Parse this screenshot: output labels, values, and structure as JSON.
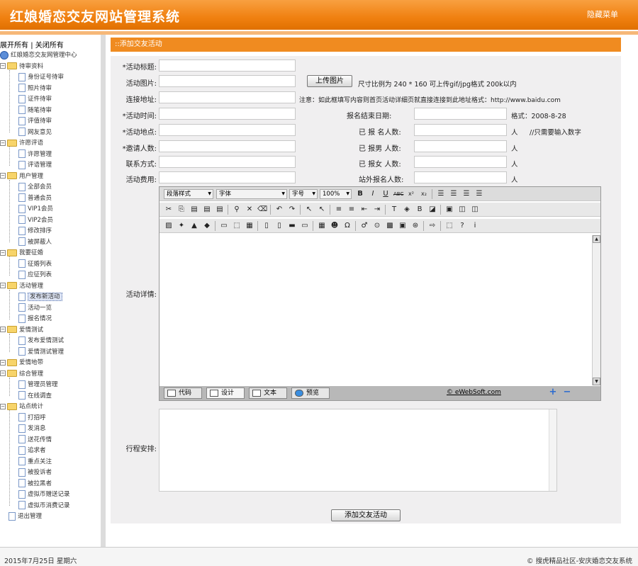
{
  "header": {
    "title": "红娘婚恋交友网站管理系统",
    "hide_menu": "隐藏菜单"
  },
  "sidebar": {
    "expand_all": "展开所有",
    "collapse_all": "关闭所有",
    "root": "红娘婚恋交友网管理中心",
    "groups": [
      {
        "label": "待审资料",
        "items": [
          "身份证号待审",
          "照片待审",
          "证件待审",
          "随笔待审",
          "评值待审",
          "网友意见"
        ]
      },
      {
        "label": "许愿评语",
        "items": [
          "许愿管理",
          "评语管理"
        ]
      },
      {
        "label": "用户管理",
        "items": [
          "全部会员",
          "普通会员",
          "VIP1会员",
          "VIP2会员",
          "修改排序",
          "被屏蔽人"
        ]
      },
      {
        "label": "我要征婚",
        "items": [
          "征婚列表",
          "应征列表"
        ]
      },
      {
        "label": "活动管理",
        "items": [
          "发布新活动",
          "活动一览",
          "报名情况"
        ]
      },
      {
        "label": "爱情测试",
        "items": [
          "发布爱情测试",
          "爱情测试管理"
        ]
      },
      {
        "label": "爱情地带",
        "items": []
      },
      {
        "label": "综合管理",
        "items": [
          "管理员管理",
          "在线调查"
        ]
      },
      {
        "label": "站点统计",
        "items": [
          "打招呼",
          "发消息",
          "送花传情",
          "追求者",
          "重点关注",
          "被投诉者",
          "被拉黑者",
          "虚拟币赠送记录",
          "虚拟币消费记录"
        ]
      }
    ],
    "logout": "退出管理"
  },
  "panel": {
    "title": "::添加交友活动"
  },
  "form": {
    "title_label": "*活动标题:",
    "image_label": "活动图片:",
    "upload_button": "上传图片",
    "image_hint": "尺寸比例为 240 * 160 可上传gif/jpg格式 200k以内",
    "link_label": "连接地址:",
    "link_hint": "注意：如此框填写内容则首页活动详细页就直接连接到此地址格式：http://www.baidu.com",
    "time_label": "*活动时间:",
    "deadline_label": "报名结束日期:",
    "deadline_hint": "格式：2008-8-28",
    "place_label": "*活动地点:",
    "signed_label": "已 报 名人数:",
    "person_unit": "人",
    "number_hint": "//只需要输入数字",
    "invite_label": "*邀请人数:",
    "male_label": "已 报男 人数:",
    "contact_label": "联系方式:",
    "female_label": "已 报女 人数:",
    "fee_label": "活动费用:",
    "external_label": "站外报名人数:",
    "detail_label": "活动详情:",
    "schedule_label": "行程安排:",
    "submit_button": "添加交友活动"
  },
  "editor": {
    "paragraph_select": "段落样式",
    "font_select": "字体",
    "size_select": "字号",
    "zoom_select": "100%",
    "mode_code": "代码",
    "mode_design": "设计",
    "mode_text": "文本",
    "mode_preview": "预览",
    "brand": "© eWebSoft.com",
    "plus": "+",
    "minus": "−"
  },
  "footer": {
    "date": "2015年7月25日 星期六",
    "credit": "© 搜虎精品社区-安庆婚恋交友系统"
  }
}
